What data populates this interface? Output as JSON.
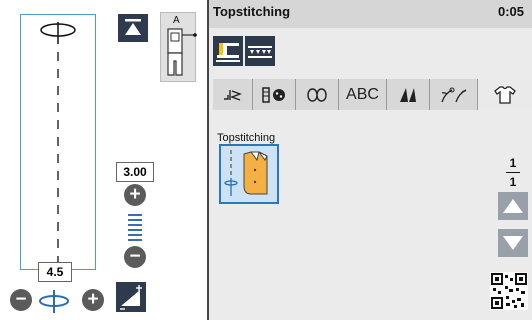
{
  "window": {
    "title": "Topstitching",
    "time": "0:05"
  },
  "left_panel": {
    "presser_foot_letter": "A",
    "stitch_length_value": "3.00",
    "stitch_width_value": "4.5"
  },
  "tabs": [
    {
      "icon": "utility-stitch-icon"
    },
    {
      "icon": "buttonhole-icon"
    },
    {
      "icon": "decorative-stitch-icon"
    },
    {
      "label": "ABC"
    },
    {
      "icon": "satin-stitch-icon"
    },
    {
      "icon": "floral-stitch-icon"
    },
    {
      "icon": "garment-icon"
    }
  ],
  "content": {
    "category_label": "Topstitching",
    "page_current": "1",
    "page_total": "1"
  },
  "colors": {
    "accent_blue": "#2a78b8",
    "dark_button": "#2d3a4c",
    "panel_grey": "#ebebeb"
  }
}
